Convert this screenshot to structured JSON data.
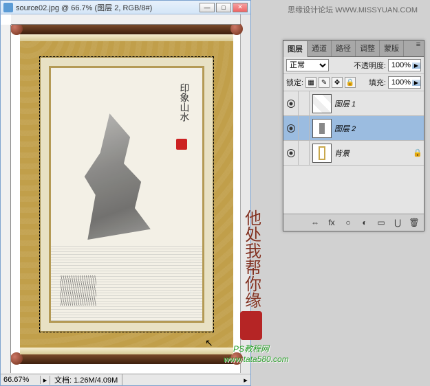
{
  "credit": "思缘设计论坛  WWW.MISSYUAN.COM",
  "doc": {
    "title": "source02.jpg @ 66.7% (图层 2, RGB/8#)",
    "zoom": "66.67%",
    "info_label": "文档:",
    "info_value": "1.26M/4.09M"
  },
  "watermark": {
    "brush": "他处我帮你缘",
    "line1": "PS教程网",
    "line2": "www.tata580.com"
  },
  "painting": {
    "calligraphy": "印象山水"
  },
  "panel": {
    "tabs": [
      "图层",
      "通道",
      "路径",
      "调整",
      "蒙版"
    ],
    "active_tab": 0,
    "blend_mode": "正常",
    "opacity_label": "不透明度:",
    "opacity_value": "100%",
    "lock_label": "锁定:",
    "fill_label": "填充:",
    "fill_value": "100%",
    "layers": [
      {
        "name": "图层 1",
        "visible": true,
        "locked": false,
        "active": false,
        "thumb": "t1"
      },
      {
        "name": "图层 2",
        "visible": true,
        "locked": false,
        "active": true,
        "thumb": "t2"
      },
      {
        "name": "背景",
        "visible": true,
        "locked": true,
        "active": false,
        "thumb": "t3"
      }
    ],
    "footer_icons": [
      "⇔",
      "fx",
      "○",
      "◐",
      "▭",
      "⋃",
      "🗑"
    ]
  }
}
